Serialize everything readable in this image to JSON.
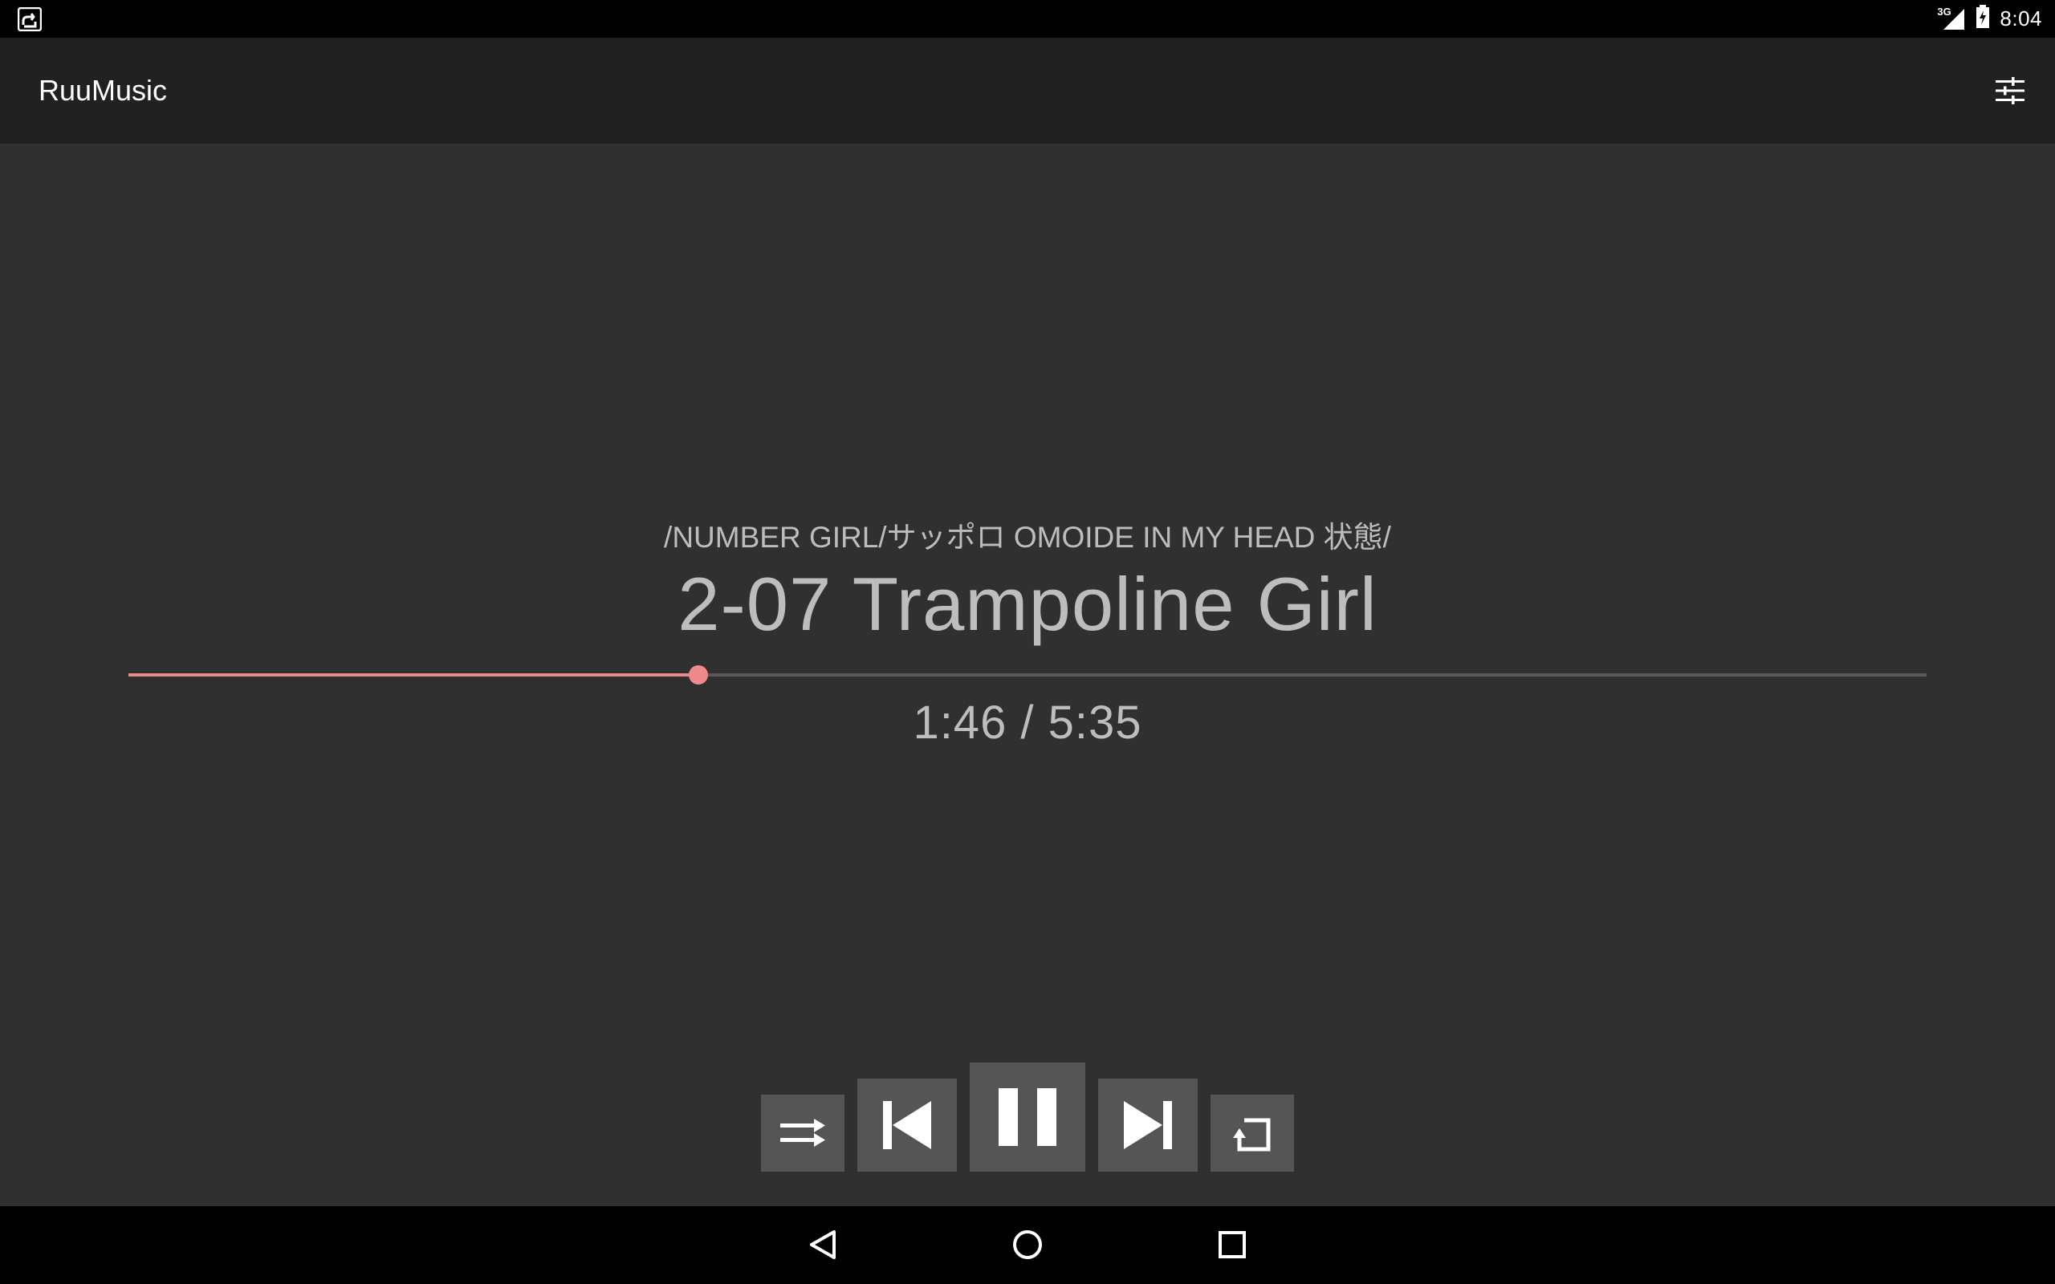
{
  "status_bar": {
    "network": "3G",
    "time": "8:04",
    "app_notification_icon": "app-notification-icon",
    "signal_icon": "signal-icon",
    "battery_icon": "battery-charging-icon"
  },
  "app_bar": {
    "title": "RuuMusic",
    "filter_icon": "tune-icon"
  },
  "player": {
    "path": "/NUMBER GIRL/サッポロ OMOIDE IN MY HEAD 状態/",
    "track_title": "2-07 Trampoline Girl",
    "elapsed": "1:46",
    "duration": "5:35",
    "time_display": "1:46 / 5:35",
    "progress_fraction": 0.317,
    "accent_color": "#f08a8a"
  },
  "controls": [
    {
      "name": "shuffle-button",
      "icon": "shuffle-icon"
    },
    {
      "name": "previous-button",
      "icon": "skip-previous-icon"
    },
    {
      "name": "pause-button",
      "icon": "pause-icon"
    },
    {
      "name": "next-button",
      "icon": "skip-next-icon"
    },
    {
      "name": "repeat-button",
      "icon": "repeat-icon"
    }
  ],
  "nav_bar": {
    "back_icon": "back-icon",
    "home_icon": "home-icon",
    "recents_icon": "recents-icon"
  }
}
